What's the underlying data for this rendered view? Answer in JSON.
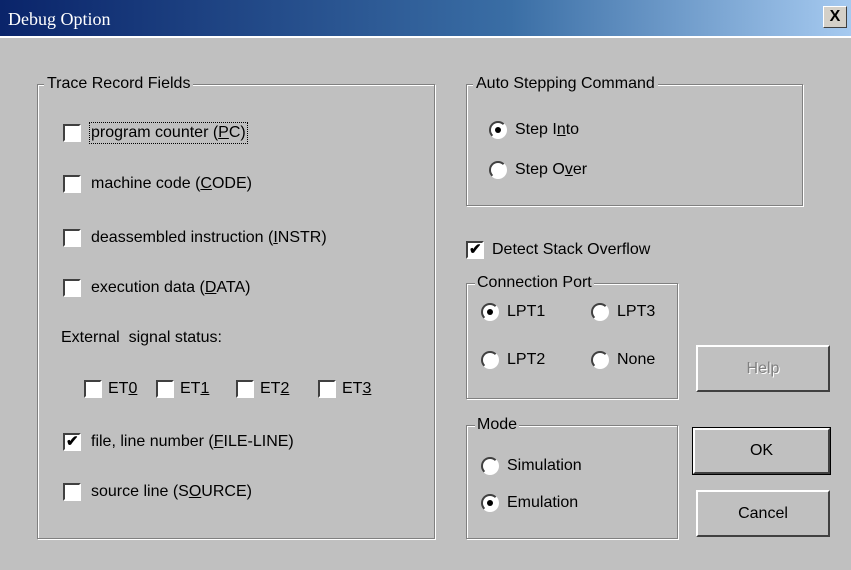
{
  "window": {
    "title": "Debug Option",
    "close_glyph": "X"
  },
  "trace": {
    "legend": "Trace Record Fields",
    "pc": {
      "pre": "program counter (",
      "key": "P",
      "post": "C)",
      "checked": false
    },
    "code": {
      "pre": "machine code (",
      "key": "C",
      "post": "ODE)",
      "checked": false
    },
    "instr": {
      "pre": "deassembled instruction (",
      "key": "I",
      "post": "NSTR)",
      "checked": false
    },
    "data": {
      "pre": "execution data (",
      "key": "D",
      "post": "ATA)",
      "checked": false
    },
    "ext_label": "External  signal status:",
    "et0": {
      "pre": "ET",
      "key": "0",
      "checked": false
    },
    "et1": {
      "pre": "ET",
      "key": "1",
      "checked": false
    },
    "et2": {
      "pre": "ET",
      "key": "2",
      "checked": false
    },
    "et3": {
      "pre": "ET",
      "key": "3",
      "checked": false
    },
    "fileline": {
      "pre": "file, line number (",
      "key": "F",
      "post": "ILE-LINE)",
      "checked": true
    },
    "source": {
      "pre": "source line (S",
      "key": "O",
      "post": "URCE)",
      "checked": false
    }
  },
  "auto_step": {
    "legend": "Auto Stepping Command",
    "into": {
      "pre": "Step I",
      "key": "n",
      "post": "to",
      "selected": true
    },
    "over": {
      "pre": "Step O",
      "key": "v",
      "post": "er",
      "selected": false
    }
  },
  "detect": {
    "label": "Detect Stack Overflow",
    "checked": true
  },
  "port": {
    "legend": "Connection Port",
    "lpt1": "LPT1",
    "lpt3": "LPT3",
    "lpt2": "LPT2",
    "none": "None",
    "selected": "LPT1"
  },
  "mode": {
    "legend": "Mode",
    "simulation": "Simulation",
    "emulation": "Emulation",
    "selected": "Emulation"
  },
  "buttons": {
    "help": "Help",
    "ok": "OK",
    "cancel": "Cancel"
  }
}
